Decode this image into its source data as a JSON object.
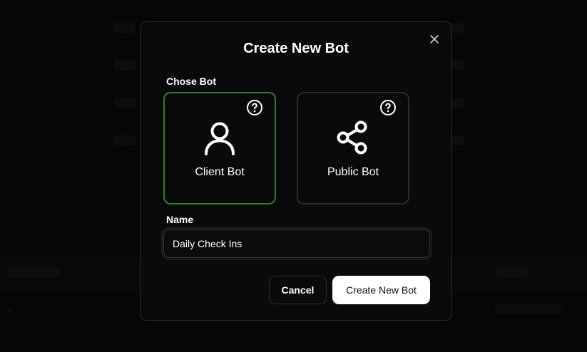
{
  "modal": {
    "title": "Create New Bot",
    "bot_section_label": "Chose Bot",
    "bot_options": [
      {
        "label": "Client Bot",
        "icon": "user-icon",
        "selected": true
      },
      {
        "label": "Public Bot",
        "icon": "share-icon",
        "selected": false
      }
    ],
    "name_label": "Name",
    "name_value": "Daily Check Ins",
    "cancel_label": "Cancel",
    "create_label": "Create New Bot"
  },
  "colors": {
    "selected_border": "#2f7a3e",
    "primary_button_bg": "#ffffff",
    "modal_bg": "#0a0a0a"
  }
}
